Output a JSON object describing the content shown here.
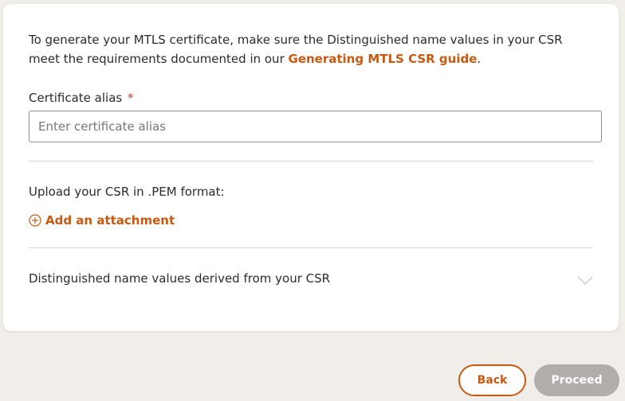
{
  "intro": {
    "text_before": "To generate your MTLS certificate, make sure the Distinguished name values in your CSR meet the requirements documented in our ",
    "link_label": "Generating MTLS CSR guide",
    "text_after": "."
  },
  "alias_field": {
    "label": "Certificate alias",
    "required_mark": "*",
    "placeholder": "Enter certificate alias",
    "value": ""
  },
  "upload": {
    "label": "Upload your CSR in .PEM format:",
    "add_attachment_label": "Add an attachment",
    "icon": "plus-circle-icon"
  },
  "distinguished_name": {
    "label": "Distinguished name values derived from your CSR",
    "icon": "chevron-down-icon",
    "expanded": false
  },
  "actions": {
    "back_label": "Back",
    "proceed_label": "Proceed",
    "proceed_enabled": false
  },
  "colors": {
    "accent": "#c75a12",
    "required": "#d0352a",
    "disabled_button": "#b0adaa",
    "page_background": "#f1eeea"
  }
}
